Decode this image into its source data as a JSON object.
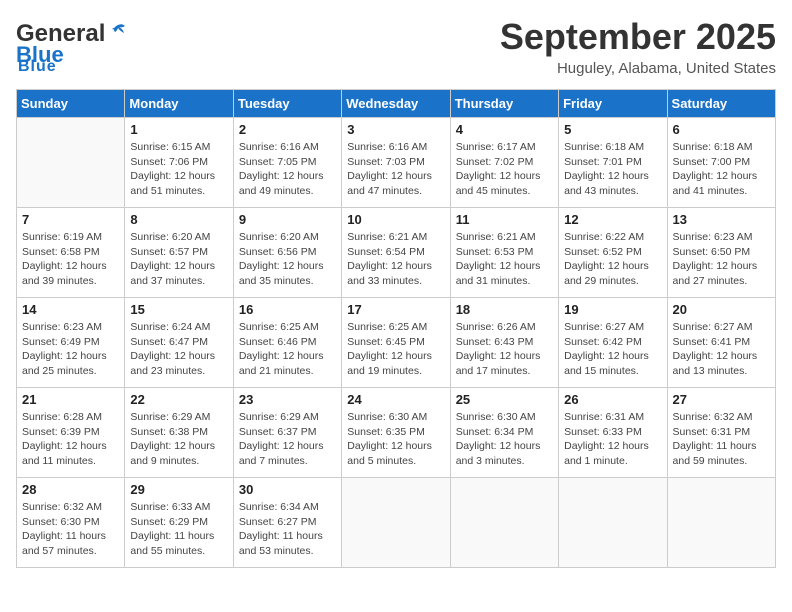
{
  "header": {
    "logo_general": "General",
    "logo_blue": "Blue",
    "title": "September 2025",
    "location": "Huguley, Alabama, United States"
  },
  "days_of_week": [
    "Sunday",
    "Monday",
    "Tuesday",
    "Wednesday",
    "Thursday",
    "Friday",
    "Saturday"
  ],
  "weeks": [
    [
      {
        "day": "",
        "sunrise": "",
        "sunset": "",
        "daylight": ""
      },
      {
        "day": "1",
        "sunrise": "Sunrise: 6:15 AM",
        "sunset": "Sunset: 7:06 PM",
        "daylight": "Daylight: 12 hours and 51 minutes."
      },
      {
        "day": "2",
        "sunrise": "Sunrise: 6:16 AM",
        "sunset": "Sunset: 7:05 PM",
        "daylight": "Daylight: 12 hours and 49 minutes."
      },
      {
        "day": "3",
        "sunrise": "Sunrise: 6:16 AM",
        "sunset": "Sunset: 7:03 PM",
        "daylight": "Daylight: 12 hours and 47 minutes."
      },
      {
        "day": "4",
        "sunrise": "Sunrise: 6:17 AM",
        "sunset": "Sunset: 7:02 PM",
        "daylight": "Daylight: 12 hours and 45 minutes."
      },
      {
        "day": "5",
        "sunrise": "Sunrise: 6:18 AM",
        "sunset": "Sunset: 7:01 PM",
        "daylight": "Daylight: 12 hours and 43 minutes."
      },
      {
        "day": "6",
        "sunrise": "Sunrise: 6:18 AM",
        "sunset": "Sunset: 7:00 PM",
        "daylight": "Daylight: 12 hours and 41 minutes."
      }
    ],
    [
      {
        "day": "7",
        "sunrise": "Sunrise: 6:19 AM",
        "sunset": "Sunset: 6:58 PM",
        "daylight": "Daylight: 12 hours and 39 minutes."
      },
      {
        "day": "8",
        "sunrise": "Sunrise: 6:20 AM",
        "sunset": "Sunset: 6:57 PM",
        "daylight": "Daylight: 12 hours and 37 minutes."
      },
      {
        "day": "9",
        "sunrise": "Sunrise: 6:20 AM",
        "sunset": "Sunset: 6:56 PM",
        "daylight": "Daylight: 12 hours and 35 minutes."
      },
      {
        "day": "10",
        "sunrise": "Sunrise: 6:21 AM",
        "sunset": "Sunset: 6:54 PM",
        "daylight": "Daylight: 12 hours and 33 minutes."
      },
      {
        "day": "11",
        "sunrise": "Sunrise: 6:21 AM",
        "sunset": "Sunset: 6:53 PM",
        "daylight": "Daylight: 12 hours and 31 minutes."
      },
      {
        "day": "12",
        "sunrise": "Sunrise: 6:22 AM",
        "sunset": "Sunset: 6:52 PM",
        "daylight": "Daylight: 12 hours and 29 minutes."
      },
      {
        "day": "13",
        "sunrise": "Sunrise: 6:23 AM",
        "sunset": "Sunset: 6:50 PM",
        "daylight": "Daylight: 12 hours and 27 minutes."
      }
    ],
    [
      {
        "day": "14",
        "sunrise": "Sunrise: 6:23 AM",
        "sunset": "Sunset: 6:49 PM",
        "daylight": "Daylight: 12 hours and 25 minutes."
      },
      {
        "day": "15",
        "sunrise": "Sunrise: 6:24 AM",
        "sunset": "Sunset: 6:47 PM",
        "daylight": "Daylight: 12 hours and 23 minutes."
      },
      {
        "day": "16",
        "sunrise": "Sunrise: 6:25 AM",
        "sunset": "Sunset: 6:46 PM",
        "daylight": "Daylight: 12 hours and 21 minutes."
      },
      {
        "day": "17",
        "sunrise": "Sunrise: 6:25 AM",
        "sunset": "Sunset: 6:45 PM",
        "daylight": "Daylight: 12 hours and 19 minutes."
      },
      {
        "day": "18",
        "sunrise": "Sunrise: 6:26 AM",
        "sunset": "Sunset: 6:43 PM",
        "daylight": "Daylight: 12 hours and 17 minutes."
      },
      {
        "day": "19",
        "sunrise": "Sunrise: 6:27 AM",
        "sunset": "Sunset: 6:42 PM",
        "daylight": "Daylight: 12 hours and 15 minutes."
      },
      {
        "day": "20",
        "sunrise": "Sunrise: 6:27 AM",
        "sunset": "Sunset: 6:41 PM",
        "daylight": "Daylight: 12 hours and 13 minutes."
      }
    ],
    [
      {
        "day": "21",
        "sunrise": "Sunrise: 6:28 AM",
        "sunset": "Sunset: 6:39 PM",
        "daylight": "Daylight: 12 hours and 11 minutes."
      },
      {
        "day": "22",
        "sunrise": "Sunrise: 6:29 AM",
        "sunset": "Sunset: 6:38 PM",
        "daylight": "Daylight: 12 hours and 9 minutes."
      },
      {
        "day": "23",
        "sunrise": "Sunrise: 6:29 AM",
        "sunset": "Sunset: 6:37 PM",
        "daylight": "Daylight: 12 hours and 7 minutes."
      },
      {
        "day": "24",
        "sunrise": "Sunrise: 6:30 AM",
        "sunset": "Sunset: 6:35 PM",
        "daylight": "Daylight: 12 hours and 5 minutes."
      },
      {
        "day": "25",
        "sunrise": "Sunrise: 6:30 AM",
        "sunset": "Sunset: 6:34 PM",
        "daylight": "Daylight: 12 hours and 3 minutes."
      },
      {
        "day": "26",
        "sunrise": "Sunrise: 6:31 AM",
        "sunset": "Sunset: 6:33 PM",
        "daylight": "Daylight: 12 hours and 1 minute."
      },
      {
        "day": "27",
        "sunrise": "Sunrise: 6:32 AM",
        "sunset": "Sunset: 6:31 PM",
        "daylight": "Daylight: 11 hours and 59 minutes."
      }
    ],
    [
      {
        "day": "28",
        "sunrise": "Sunrise: 6:32 AM",
        "sunset": "Sunset: 6:30 PM",
        "daylight": "Daylight: 11 hours and 57 minutes."
      },
      {
        "day": "29",
        "sunrise": "Sunrise: 6:33 AM",
        "sunset": "Sunset: 6:29 PM",
        "daylight": "Daylight: 11 hours and 55 minutes."
      },
      {
        "day": "30",
        "sunrise": "Sunrise: 6:34 AM",
        "sunset": "Sunset: 6:27 PM",
        "daylight": "Daylight: 11 hours and 53 minutes."
      },
      {
        "day": "",
        "sunrise": "",
        "sunset": "",
        "daylight": ""
      },
      {
        "day": "",
        "sunrise": "",
        "sunset": "",
        "daylight": ""
      },
      {
        "day": "",
        "sunrise": "",
        "sunset": "",
        "daylight": ""
      },
      {
        "day": "",
        "sunrise": "",
        "sunset": "",
        "daylight": ""
      }
    ]
  ]
}
